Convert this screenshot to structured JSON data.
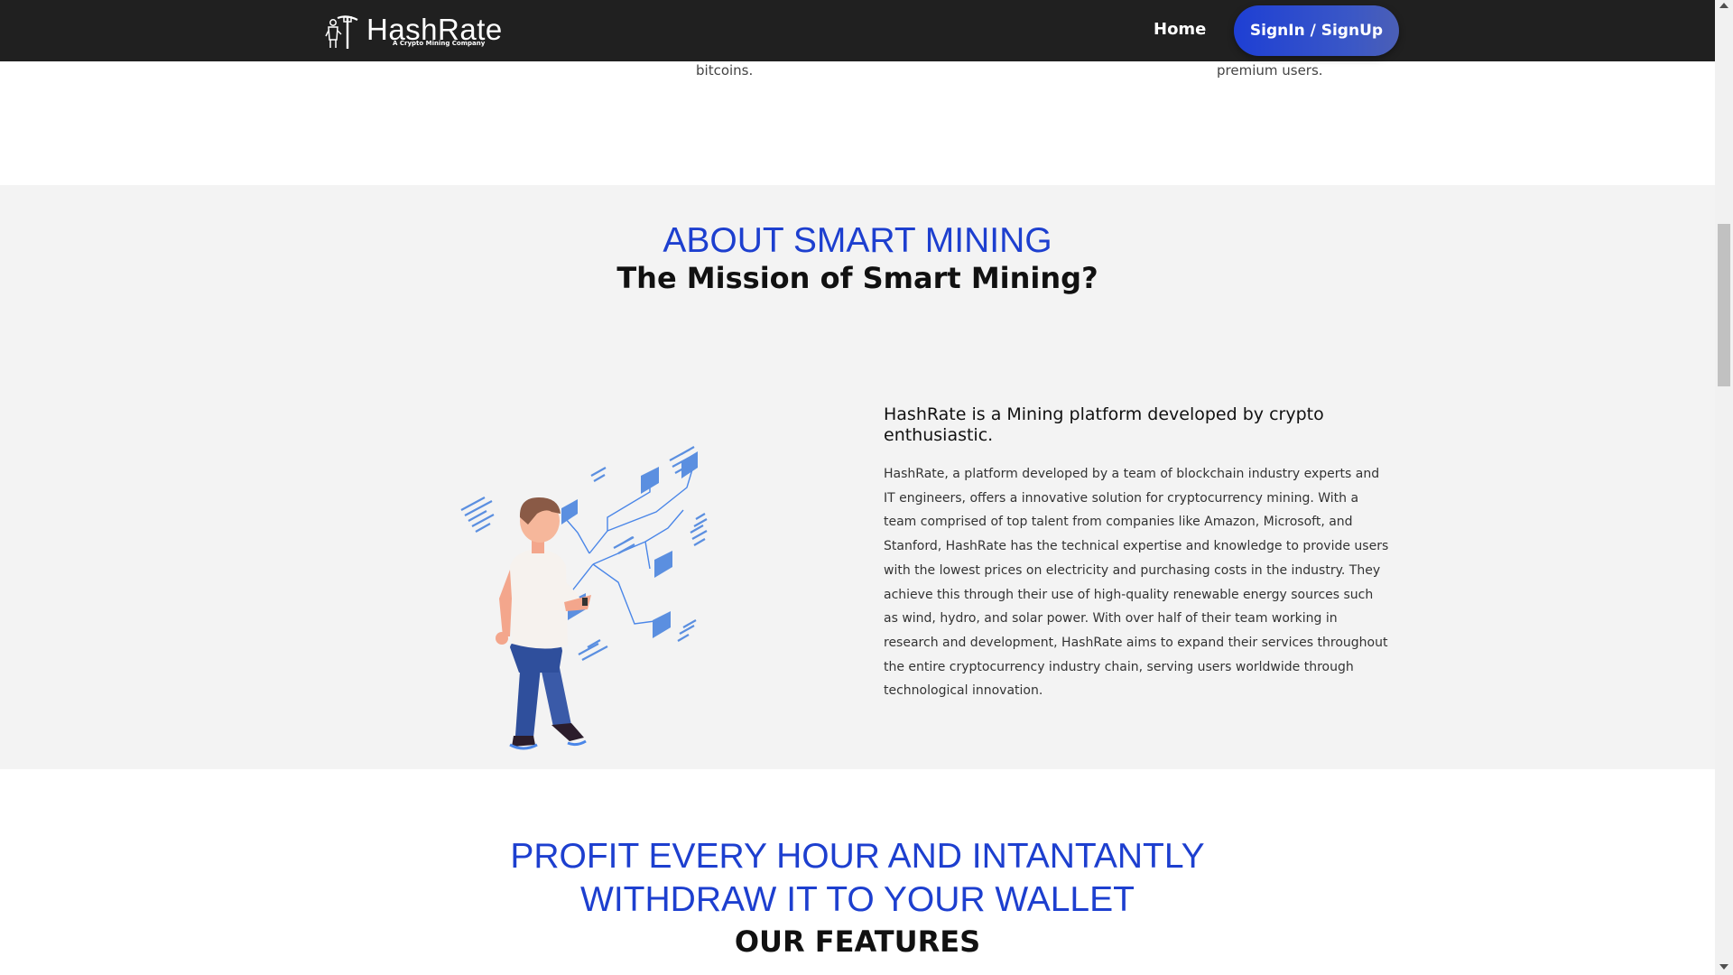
{
  "header": {
    "logo_name": "HashRate",
    "logo_tagline": "A Crypto Mining Company",
    "nav_home": "Home",
    "signin_label": "SignIn / SignUp"
  },
  "previous_section": {
    "left_fragment": "bitcoins.",
    "right_fragment": "premium users."
  },
  "about": {
    "title": "ABOUT SMART MINING",
    "subtitle": "The Mission of Smart Mining?",
    "lead": "HashRate is a Mining platform developed by crypto enthusiastic.",
    "body": "HashRate, a platform developed by a team of blockchain industry experts and IT engineers, offers a innovative solution for cryptocurrency mining. With a team comprised of top talent from companies like Amazon, Microsoft, and Stanford, HashRate has the technical expertise and knowledge to provide users with the lowest prices on electricity and purchasing costs in the industry. They achieve this through their use of high-quality renewable energy sources such as wind, hydro, and solar power. With over half of their team working in research and development, HashRate aims to expand their services throughout the entire cryptocurrency industry chain, serving users worldwide through technological innovation."
  },
  "profit": {
    "title_line1": "PROFIT EVERY HOUR AND INTANTANTLY",
    "title_line2": "WITHDRAW IT TO YOUR WALLET",
    "features_title": "OUR FEATURES"
  },
  "colors": {
    "header_bg": "#202020",
    "accent_blue": "#1d3fcf",
    "section_bg": "#f3f3f3"
  }
}
